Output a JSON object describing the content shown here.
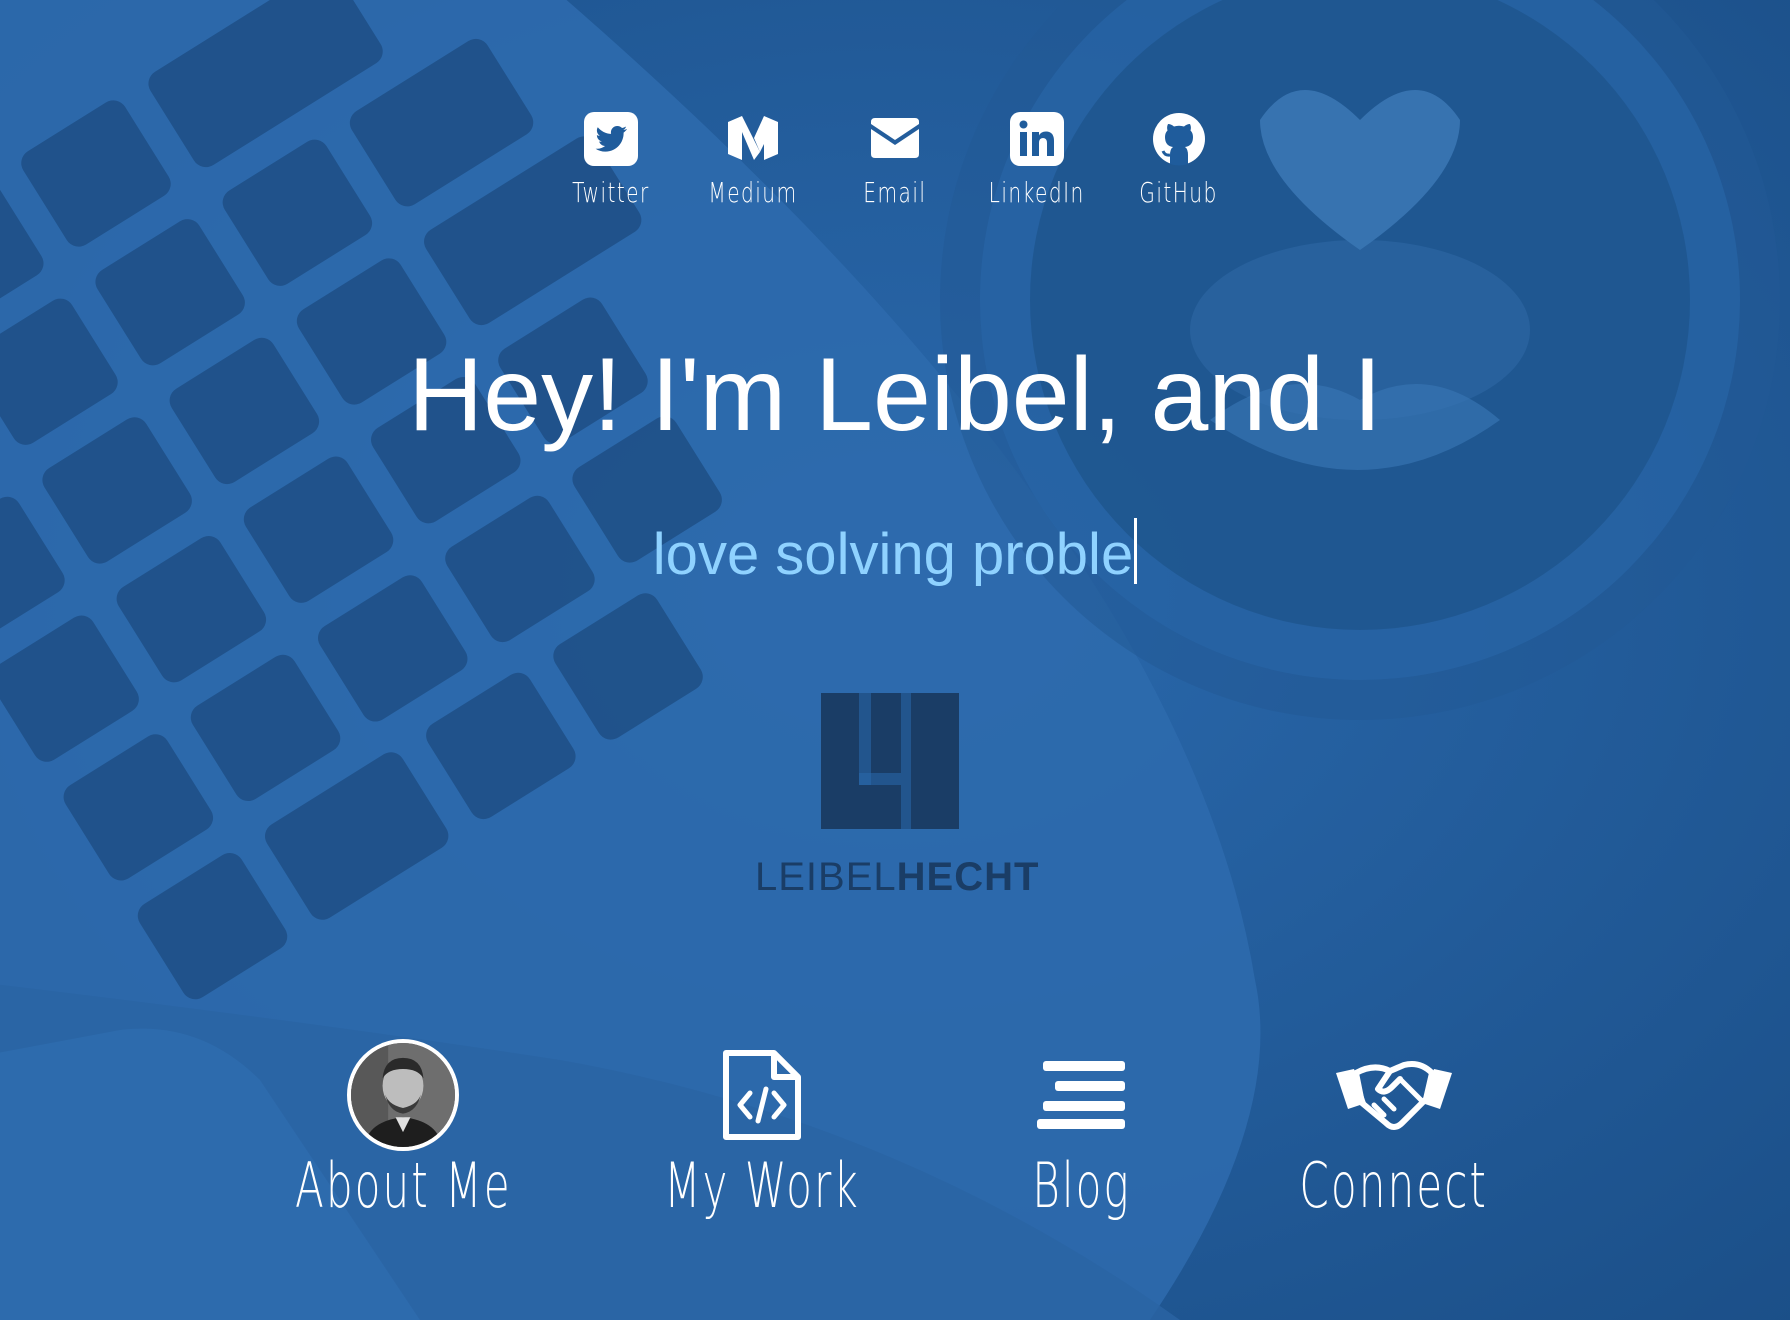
{
  "social_links": [
    {
      "label": "Twitter",
      "icon": "twitter-icon"
    },
    {
      "label": "Medium",
      "icon": "medium-icon"
    },
    {
      "label": "Email",
      "icon": "email-icon"
    },
    {
      "label": "LinkedIn",
      "icon": "linkedin-icon"
    },
    {
      "label": "GitHub",
      "icon": "github-icon"
    }
  ],
  "hero": {
    "headline": "Hey! I'm Leibel, and I",
    "typed_text": "love solving proble"
  },
  "logo": {
    "wordmark_light": "LEIBEL",
    "wordmark_bold": "HECHT"
  },
  "nav": [
    {
      "label": "About Me",
      "icon": "avatar-photo"
    },
    {
      "label": "My Work",
      "icon": "code-file-icon"
    },
    {
      "label": "Blog",
      "icon": "blog-lines-icon"
    },
    {
      "label": "Connect",
      "icon": "handshake-icon"
    }
  ],
  "colors": {
    "background_blue": "#1f5c9c",
    "typed_text": "#8fd2ff",
    "logo": "#1a3d66",
    "text": "#ffffff"
  }
}
